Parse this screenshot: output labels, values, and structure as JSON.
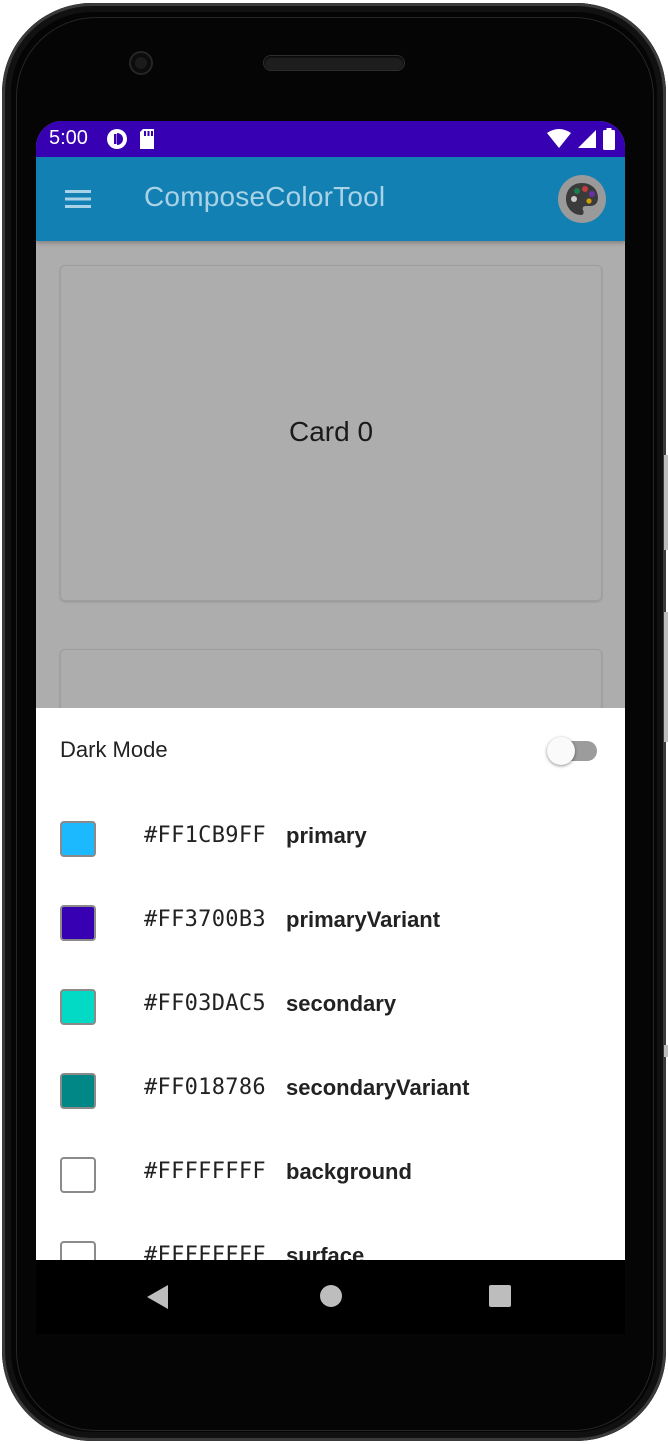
{
  "status_bar": {
    "time": "5:00"
  },
  "app_bar": {
    "title": "ComposeColorTool",
    "menu_icon": "menu-icon",
    "action_icon": "palette-icon"
  },
  "cards": [
    {
      "label": "Card 0"
    },
    {
      "label": ""
    }
  ],
  "sheet": {
    "dark_mode": {
      "label": "Dark Mode",
      "enabled": false
    },
    "colors": [
      {
        "hex": "#FF1CB9FF",
        "name": "primary",
        "swatch": "#1CB9FF"
      },
      {
        "hex": "#FF3700B3",
        "name": "primaryVariant",
        "swatch": "#3700B3"
      },
      {
        "hex": "#FF03DAC5",
        "name": "secondary",
        "swatch": "#03DAC5"
      },
      {
        "hex": "#FF018786",
        "name": "secondaryVariant",
        "swatch": "#018786"
      },
      {
        "hex": "#FFFFFFFF",
        "name": "background",
        "swatch": "#FFFFFF"
      },
      {
        "hex": "#FFFFFFFF",
        "name": "surface",
        "swatch": "#FFFFFF"
      }
    ]
  },
  "theme": {
    "status_bar_color": "#3700B3",
    "app_bar_color": "#1380B4",
    "scrim_color": "#ADADAD"
  },
  "nav": {
    "back_icon": "back-triangle-icon",
    "home_icon": "home-circle-icon",
    "recents_icon": "recents-square-icon"
  }
}
